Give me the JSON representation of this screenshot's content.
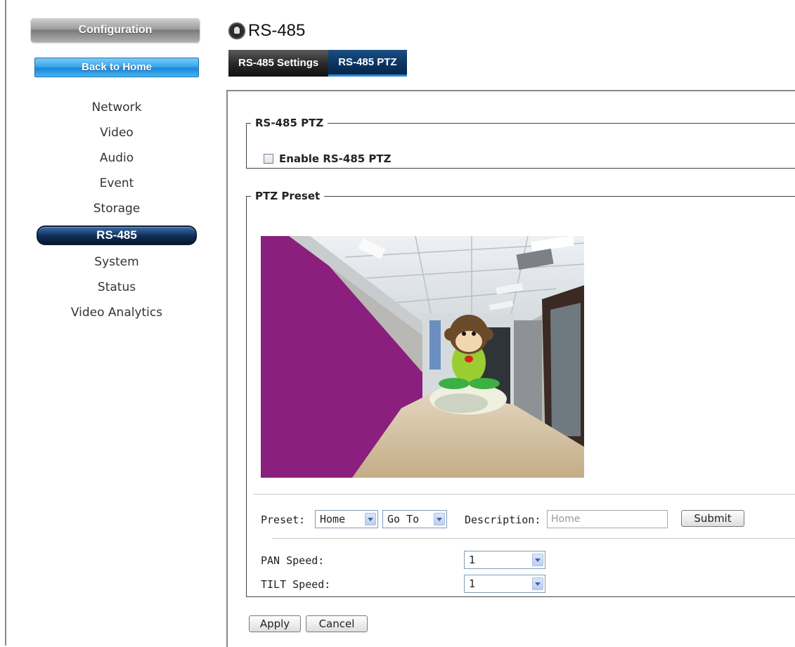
{
  "sidebar": {
    "config_label": "Configuration",
    "home_label": "Back to Home",
    "items": [
      {
        "label": "Network"
      },
      {
        "label": "Video"
      },
      {
        "label": "Audio"
      },
      {
        "label": "Event"
      },
      {
        "label": "Storage"
      },
      {
        "label": "RS-485",
        "active": true
      },
      {
        "label": "System"
      },
      {
        "label": "Status"
      },
      {
        "label": "Video Analytics"
      }
    ]
  },
  "header": {
    "title": "RS-485",
    "title_icon": "camera-lens-icon",
    "tabs": [
      {
        "label": "RS-485 Settings",
        "active": false
      },
      {
        "label": "RS-485 PTZ",
        "active": true
      }
    ]
  },
  "ptz": {
    "legend": "RS-485 PTZ",
    "enable_label": "Enable RS-485 PTZ",
    "enabled": false
  },
  "preset": {
    "legend": "PTZ Preset",
    "preset_label": "Preset:",
    "preset_value": "Home",
    "action_value": "Go To",
    "description_label": "Description:",
    "description_placeholder": "Home",
    "submit_label": "Submit",
    "pan_label": "PAN Speed:",
    "pan_value": "1",
    "tilt_label": "TILT Speed:",
    "tilt_value": "1"
  },
  "actions": {
    "apply_label": "Apply",
    "cancel_label": "Cancel"
  },
  "colors": {
    "active_nav": "#0f2d56",
    "home_button": "#3ba6ea",
    "active_tab": "#0c3766"
  }
}
